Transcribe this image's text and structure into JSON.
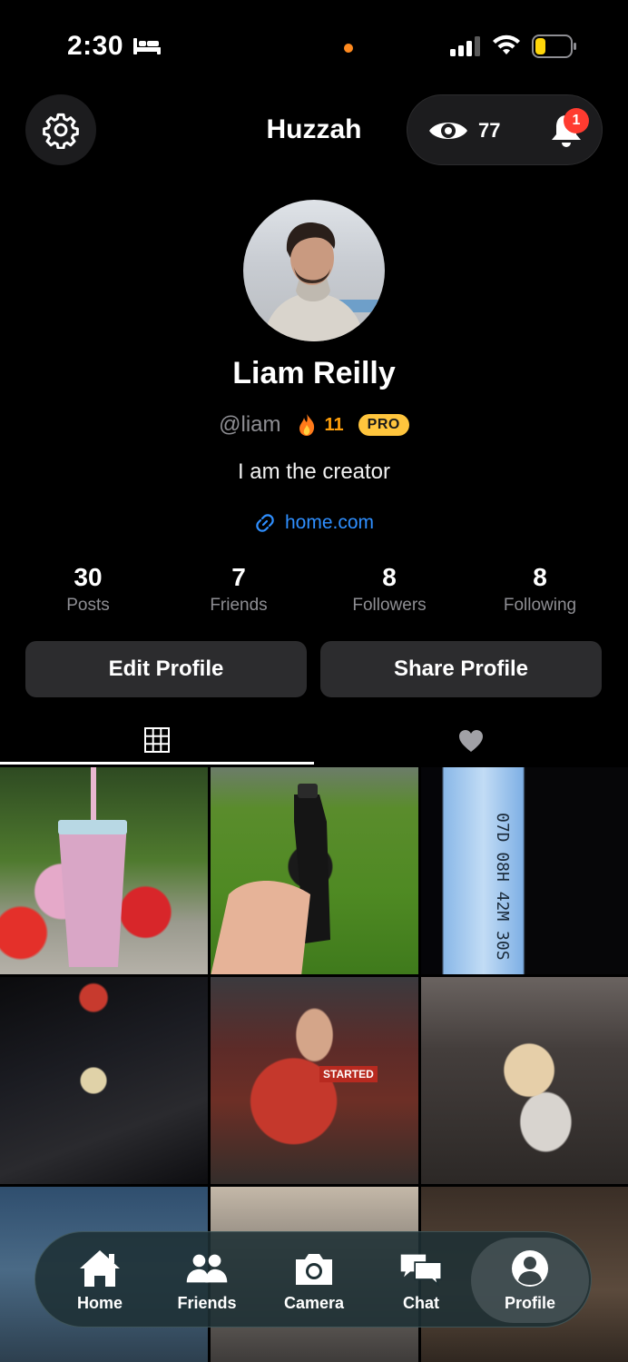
{
  "status_bar": {
    "time": "2:30",
    "recording_dot_color": "#ff8a1f",
    "battery_color": "#ffd60a",
    "icons": [
      "bed-icon",
      "signal-icon",
      "wifi-icon",
      "battery-icon"
    ]
  },
  "header": {
    "title": "Huzzah",
    "settings_icon": "gear-icon",
    "views_icon": "eye-icon",
    "views_count": "77",
    "notifications_icon": "bell-icon",
    "notification_badge": "1"
  },
  "profile": {
    "display_name": "Liam Reilly",
    "handle": "@liam",
    "streak_icon": "flame-icon",
    "streak_count": "11",
    "pro_badge": "PRO",
    "bio": "I am the creator",
    "link_icon": "link-icon",
    "link": "home.com"
  },
  "stats": [
    {
      "value": "30",
      "label": "Posts"
    },
    {
      "value": "7",
      "label": "Friends"
    },
    {
      "value": "8",
      "label": "Followers"
    },
    {
      "value": "8",
      "label": "Following"
    }
  ],
  "actions": {
    "edit_label": "Edit Profile",
    "share_label": "Share Profile"
  },
  "tabs": [
    {
      "icon": "grid-icon",
      "active": true
    },
    {
      "icon": "heart-icon",
      "active": false
    }
  ],
  "posts": [
    {
      "subject": "pink studded tumbler with red flowers"
    },
    {
      "subject": "hand holding black water bottle on grass"
    },
    {
      "subject": "countdown timer on phone screen",
      "overlay_text": "07D 08H 42M 30S"
    },
    {
      "subject": "dark restaurant interior"
    },
    {
      "subject": "woman holding restaurant menu",
      "overlay_text": "STARTED"
    },
    {
      "subject": "woman in car seat"
    },
    {
      "subject": "outdoor landscape"
    },
    {
      "subject": "indoor photo"
    },
    {
      "subject": "indoor photo"
    }
  ],
  "bottom_nav": {
    "items": [
      {
        "label": "Home",
        "icon": "home-icon"
      },
      {
        "label": "Friends",
        "icon": "friends-icon"
      },
      {
        "label": "Camera",
        "icon": "camera-icon"
      },
      {
        "label": "Chat",
        "icon": "chat-icon"
      },
      {
        "label": "Profile",
        "icon": "profile-icon",
        "active": true
      }
    ]
  }
}
